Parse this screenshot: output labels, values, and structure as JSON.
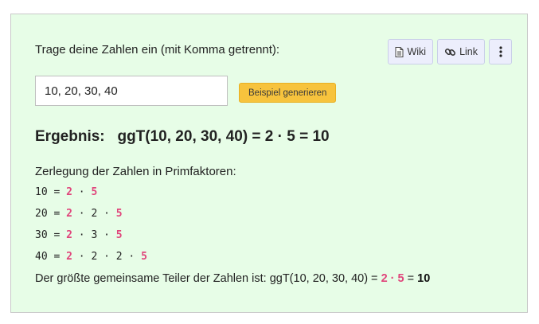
{
  "prompt": "Trage deine Zahlen ein (mit Komma getrennt):",
  "toolbar": {
    "wiki_label": "Wiki",
    "link_label": "Link"
  },
  "input": {
    "value": "10, 20, 30, 40"
  },
  "example_button": "Beispiel generieren",
  "result": {
    "label": "Ergebnis:",
    "expression": "ggT(10, 20, 30, 40) = 2 · 5 = 10"
  },
  "decomposition": {
    "title": "Zerlegung der Zahlen in Primfaktoren:",
    "rows": [
      {
        "number": "10",
        "factors": [
          {
            "f": "2",
            "common": true
          },
          {
            "f": "5",
            "common": true
          }
        ]
      },
      {
        "number": "20",
        "factors": [
          {
            "f": "2",
            "common": true
          },
          {
            "f": "2",
            "common": false
          },
          {
            "f": "5",
            "common": true
          }
        ]
      },
      {
        "number": "30",
        "factors": [
          {
            "f": "2",
            "common": true
          },
          {
            "f": "3",
            "common": false
          },
          {
            "f": "5",
            "common": true
          }
        ]
      },
      {
        "number": "40",
        "factors": [
          {
            "f": "2",
            "common": true
          },
          {
            "f": "2",
            "common": false
          },
          {
            "f": "2",
            "common": false
          },
          {
            "f": "5",
            "common": true
          }
        ]
      }
    ]
  },
  "conclusion": {
    "text": "Der größte gemeinsame Teiler der Zahlen ist: ggT(10, 20, 30, 40) =",
    "factor1": "2",
    "dot": "·",
    "factor2": "5",
    "equals": "=",
    "value": "10"
  },
  "colors": {
    "panel_bg": "#e7fde7",
    "highlight": "#e0457b",
    "example_button": "#f7c33d"
  }
}
